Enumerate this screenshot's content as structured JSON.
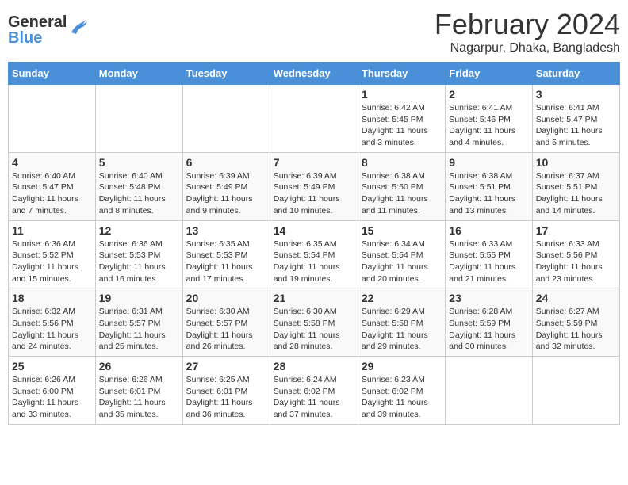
{
  "logo": {
    "general": "General",
    "blue": "Blue"
  },
  "title": {
    "month_year": "February 2024",
    "location": "Nagarpur, Dhaka, Bangladesh"
  },
  "weekdays": [
    "Sunday",
    "Monday",
    "Tuesday",
    "Wednesday",
    "Thursday",
    "Friday",
    "Saturday"
  ],
  "weeks": [
    [
      {
        "day": "",
        "info": ""
      },
      {
        "day": "",
        "info": ""
      },
      {
        "day": "",
        "info": ""
      },
      {
        "day": "",
        "info": ""
      },
      {
        "day": "1",
        "info": "Sunrise: 6:42 AM\nSunset: 5:45 PM\nDaylight: 11 hours and 3 minutes."
      },
      {
        "day": "2",
        "info": "Sunrise: 6:41 AM\nSunset: 5:46 PM\nDaylight: 11 hours and 4 minutes."
      },
      {
        "day": "3",
        "info": "Sunrise: 6:41 AM\nSunset: 5:47 PM\nDaylight: 11 hours and 5 minutes."
      }
    ],
    [
      {
        "day": "4",
        "info": "Sunrise: 6:40 AM\nSunset: 5:47 PM\nDaylight: 11 hours and 7 minutes."
      },
      {
        "day": "5",
        "info": "Sunrise: 6:40 AM\nSunset: 5:48 PM\nDaylight: 11 hours and 8 minutes."
      },
      {
        "day": "6",
        "info": "Sunrise: 6:39 AM\nSunset: 5:49 PM\nDaylight: 11 hours and 9 minutes."
      },
      {
        "day": "7",
        "info": "Sunrise: 6:39 AM\nSunset: 5:49 PM\nDaylight: 11 hours and 10 minutes."
      },
      {
        "day": "8",
        "info": "Sunrise: 6:38 AM\nSunset: 5:50 PM\nDaylight: 11 hours and 11 minutes."
      },
      {
        "day": "9",
        "info": "Sunrise: 6:38 AM\nSunset: 5:51 PM\nDaylight: 11 hours and 13 minutes."
      },
      {
        "day": "10",
        "info": "Sunrise: 6:37 AM\nSunset: 5:51 PM\nDaylight: 11 hours and 14 minutes."
      }
    ],
    [
      {
        "day": "11",
        "info": "Sunrise: 6:36 AM\nSunset: 5:52 PM\nDaylight: 11 hours and 15 minutes."
      },
      {
        "day": "12",
        "info": "Sunrise: 6:36 AM\nSunset: 5:53 PM\nDaylight: 11 hours and 16 minutes."
      },
      {
        "day": "13",
        "info": "Sunrise: 6:35 AM\nSunset: 5:53 PM\nDaylight: 11 hours and 17 minutes."
      },
      {
        "day": "14",
        "info": "Sunrise: 6:35 AM\nSunset: 5:54 PM\nDaylight: 11 hours and 19 minutes."
      },
      {
        "day": "15",
        "info": "Sunrise: 6:34 AM\nSunset: 5:54 PM\nDaylight: 11 hours and 20 minutes."
      },
      {
        "day": "16",
        "info": "Sunrise: 6:33 AM\nSunset: 5:55 PM\nDaylight: 11 hours and 21 minutes."
      },
      {
        "day": "17",
        "info": "Sunrise: 6:33 AM\nSunset: 5:56 PM\nDaylight: 11 hours and 23 minutes."
      }
    ],
    [
      {
        "day": "18",
        "info": "Sunrise: 6:32 AM\nSunset: 5:56 PM\nDaylight: 11 hours and 24 minutes."
      },
      {
        "day": "19",
        "info": "Sunrise: 6:31 AM\nSunset: 5:57 PM\nDaylight: 11 hours and 25 minutes."
      },
      {
        "day": "20",
        "info": "Sunrise: 6:30 AM\nSunset: 5:57 PM\nDaylight: 11 hours and 26 minutes."
      },
      {
        "day": "21",
        "info": "Sunrise: 6:30 AM\nSunset: 5:58 PM\nDaylight: 11 hours and 28 minutes."
      },
      {
        "day": "22",
        "info": "Sunrise: 6:29 AM\nSunset: 5:58 PM\nDaylight: 11 hours and 29 minutes."
      },
      {
        "day": "23",
        "info": "Sunrise: 6:28 AM\nSunset: 5:59 PM\nDaylight: 11 hours and 30 minutes."
      },
      {
        "day": "24",
        "info": "Sunrise: 6:27 AM\nSunset: 5:59 PM\nDaylight: 11 hours and 32 minutes."
      }
    ],
    [
      {
        "day": "25",
        "info": "Sunrise: 6:26 AM\nSunset: 6:00 PM\nDaylight: 11 hours and 33 minutes."
      },
      {
        "day": "26",
        "info": "Sunrise: 6:26 AM\nSunset: 6:01 PM\nDaylight: 11 hours and 35 minutes."
      },
      {
        "day": "27",
        "info": "Sunrise: 6:25 AM\nSunset: 6:01 PM\nDaylight: 11 hours and 36 minutes."
      },
      {
        "day": "28",
        "info": "Sunrise: 6:24 AM\nSunset: 6:02 PM\nDaylight: 11 hours and 37 minutes."
      },
      {
        "day": "29",
        "info": "Sunrise: 6:23 AM\nSunset: 6:02 PM\nDaylight: 11 hours and 39 minutes."
      },
      {
        "day": "",
        "info": ""
      },
      {
        "day": "",
        "info": ""
      }
    ]
  ]
}
